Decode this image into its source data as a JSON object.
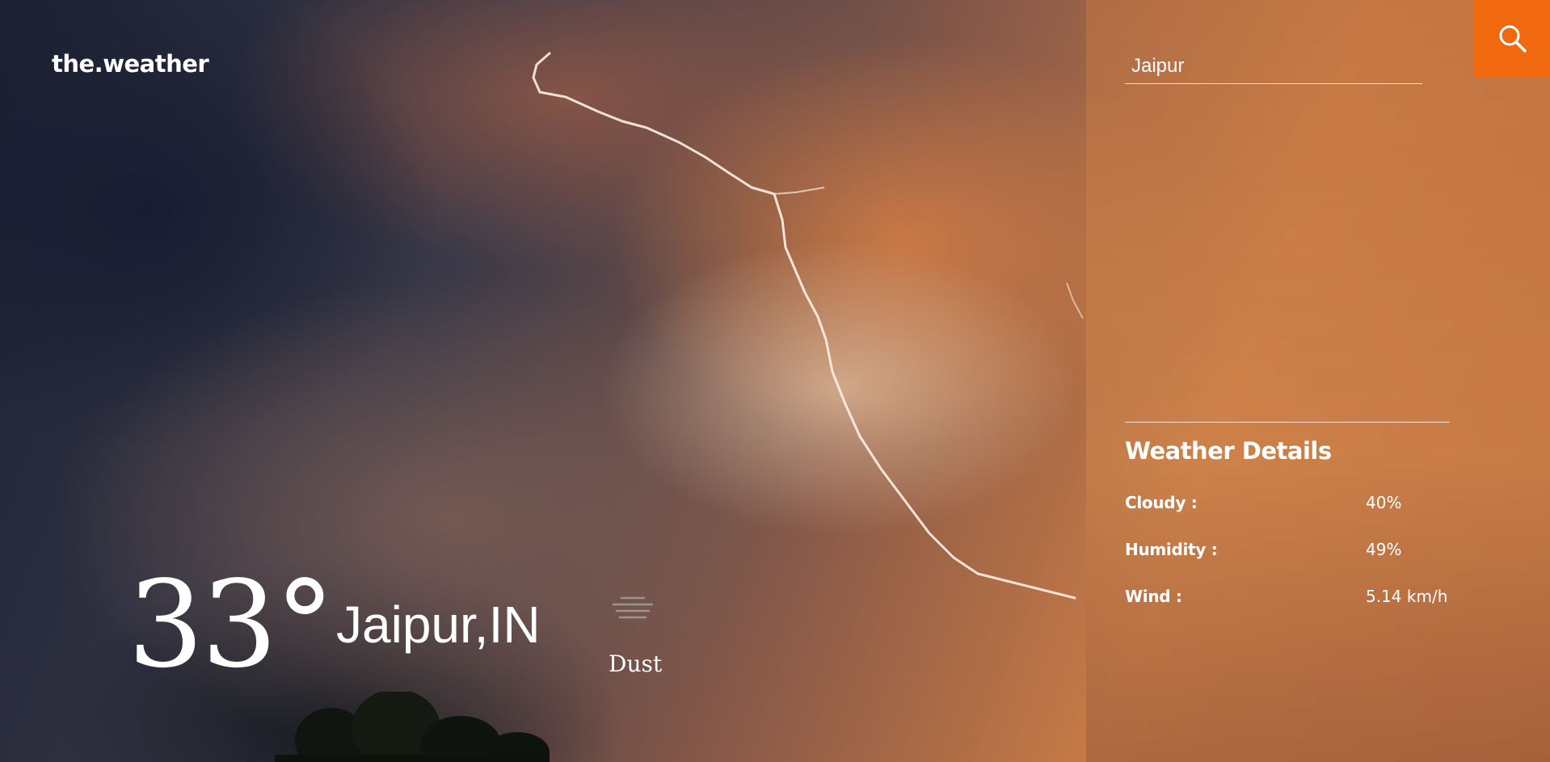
{
  "app": {
    "logo": "the.weather"
  },
  "search": {
    "value": "Jaipur",
    "button_icon": "search-icon",
    "button_color": "#f0690f"
  },
  "current": {
    "temperature": "33°",
    "location": "Jaipur,IN",
    "condition": "Dust",
    "condition_icon": "dust-haze-icon"
  },
  "details": {
    "title": "Weather Details",
    "items": [
      {
        "label": "Cloudy :",
        "value": "40%"
      },
      {
        "label": "Humidity :",
        "value": "49%"
      },
      {
        "label": "Wind :",
        "value": "5.14 km/h"
      }
    ]
  }
}
